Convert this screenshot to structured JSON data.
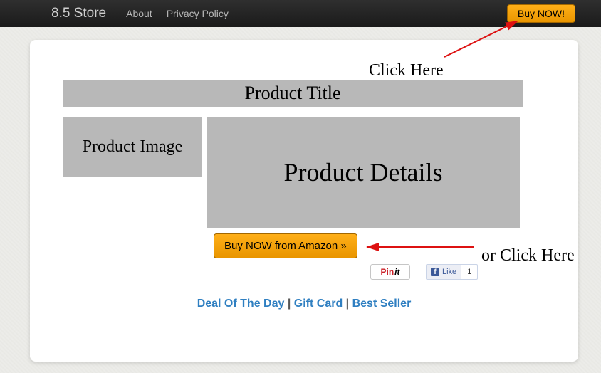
{
  "nav": {
    "brand": "8.5 Store",
    "about": "About",
    "privacy": "Privacy Policy",
    "buy_now": "Buy NOW!"
  },
  "annotations": {
    "click_here": "Click Here",
    "or_click_here": "or Click Here"
  },
  "product": {
    "title": "Product Title",
    "image_placeholder": "Product Image",
    "details_placeholder": "Product Details",
    "buy_amazon_label": "Buy NOW from Amazon »"
  },
  "social": {
    "pin_prefix": "Pin",
    "pin_suffix": "it",
    "fb_like_label": "Like",
    "fb_like_count": "1"
  },
  "footer": {
    "deal": "Deal Of The Day",
    "gift": "Gift Card",
    "best": "Best Seller",
    "sep": " | "
  }
}
